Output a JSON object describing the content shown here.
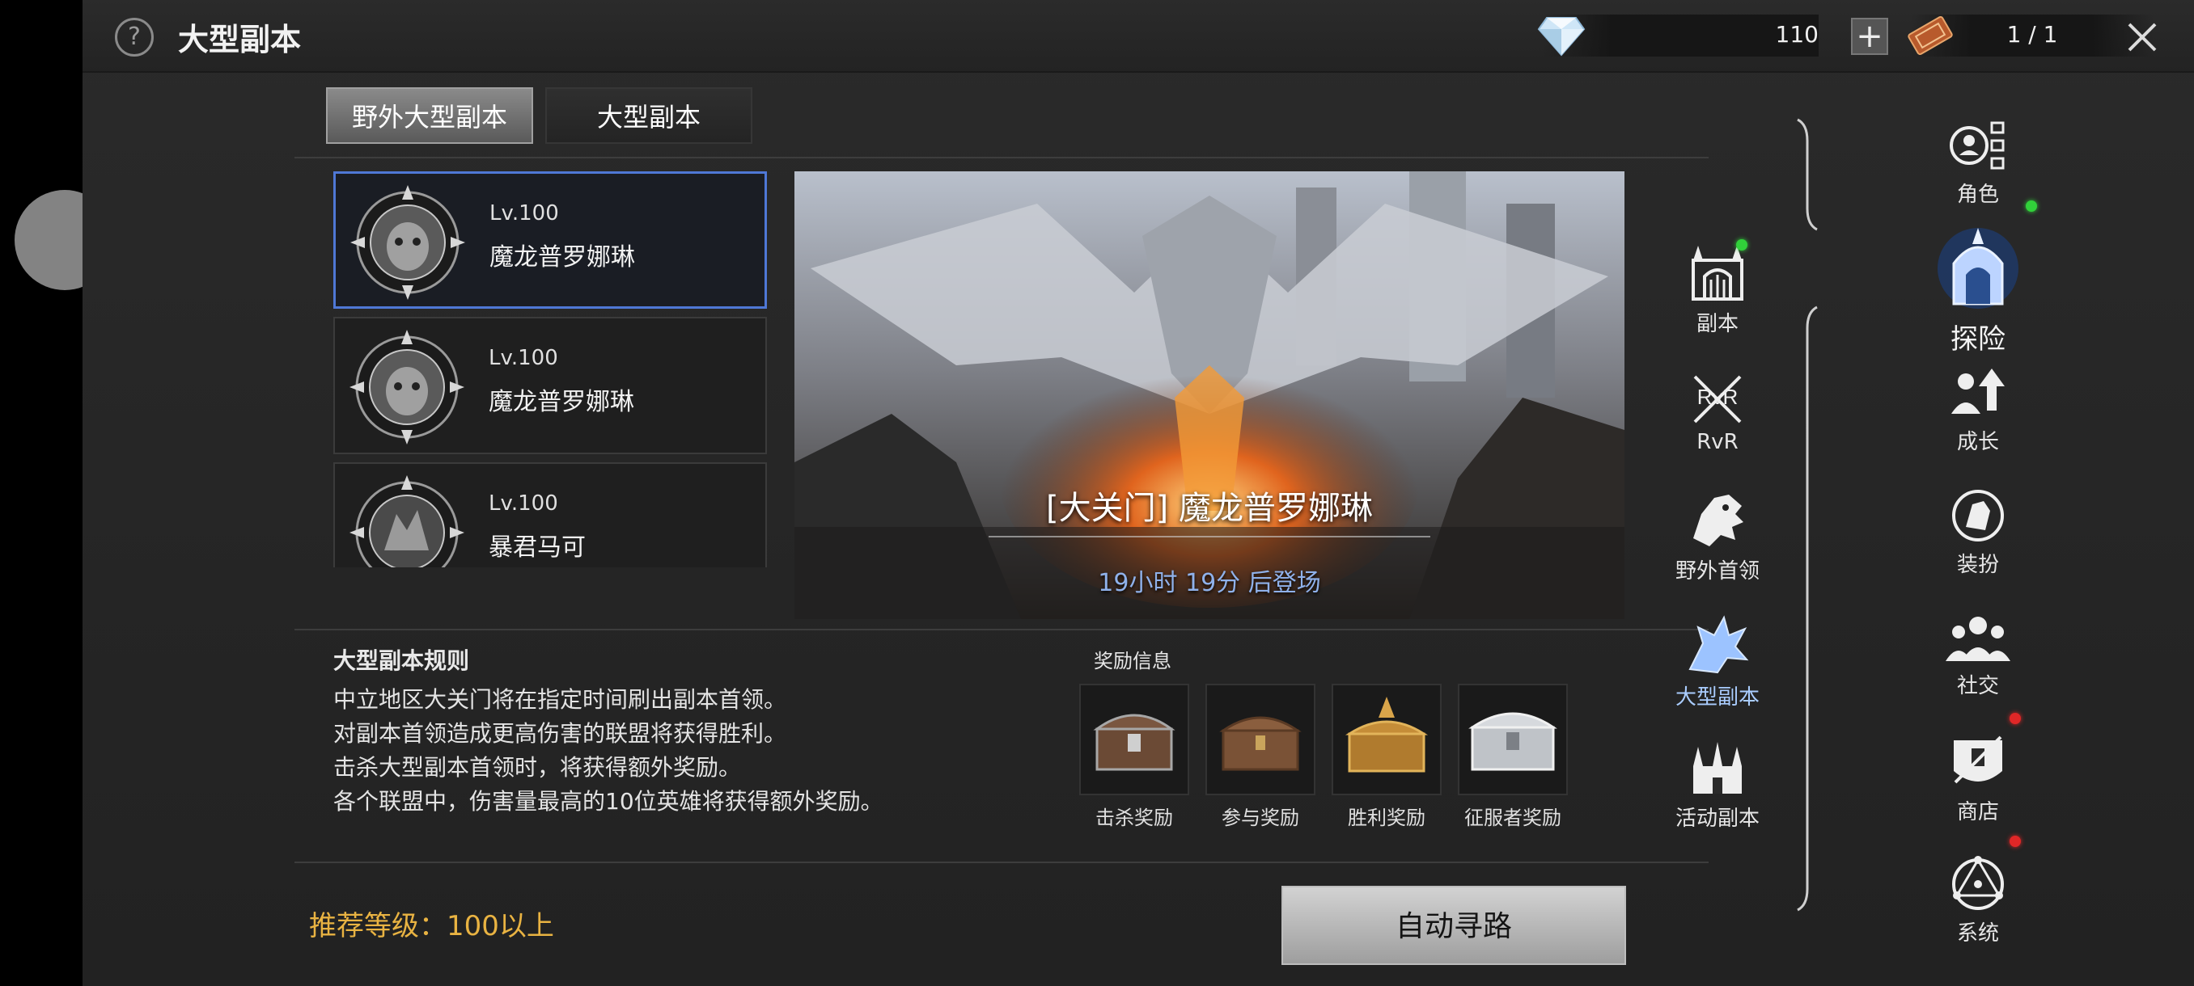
{
  "header": {
    "title": "大型副本",
    "gem_value": "110",
    "ticket_value": "1 / 1",
    "plus_label": "+"
  },
  "tabs": [
    {
      "label": "野外大型副本",
      "active": true
    },
    {
      "label": "大型副本",
      "active": false
    }
  ],
  "bosses": [
    {
      "level": "Lv.100",
      "name": "魔龙普罗娜琳",
      "selected": true
    },
    {
      "level": "Lv.100",
      "name": "魔龙普罗娜琳",
      "selected": false
    },
    {
      "level": "Lv.100",
      "name": "暴君马可",
      "selected": false
    }
  ],
  "banner": {
    "title": "[大关门] 魔龙普罗娜琳",
    "time": "19小时 19分 后登场"
  },
  "rules": {
    "title": "大型副本规则",
    "lines": [
      "中立地区大关门将在指定时间刷出副本首领。",
      "对副本首领造成更高伤害的联盟将获得胜利。",
      "击杀大型副本首领时，将获得额外奖励。",
      "各个联盟中，伤害量最高的10位英雄将获得额外奖励。"
    ]
  },
  "rewards": {
    "title": "奖励信息",
    "items": [
      {
        "label": "击杀奖励",
        "icon": "kill-reward-chest"
      },
      {
        "label": "参与奖励",
        "icon": "participation-reward-chest"
      },
      {
        "label": "胜利奖励",
        "icon": "victory-reward-chest"
      },
      {
        "label": "征服者奖励",
        "icon": "conqueror-reward-chest"
      }
    ]
  },
  "footer": {
    "recommend": "推荐等级：100以上",
    "auto_path": "自动寻路"
  },
  "mid_nav": [
    {
      "label": "副本",
      "icon": "gate-icon",
      "badge": "green"
    },
    {
      "label": "RvR",
      "icon": "rvr-swords-icon",
      "badge": null
    },
    {
      "label": "野外首领",
      "icon": "dragon-head-icon",
      "badge": null
    },
    {
      "label": "大型副本",
      "icon": "raid-dragon-icon",
      "badge": null,
      "active": true
    },
    {
      "label": "活动副本",
      "icon": "castle-icon",
      "badge": null
    }
  ],
  "right_nav": [
    {
      "label": "角色",
      "icon": "character-icon",
      "badge": null
    },
    {
      "label": "探险",
      "icon": "adventure-icon",
      "badge": "green",
      "active": true
    },
    {
      "label": "成长",
      "icon": "growth-icon",
      "badge": null
    },
    {
      "label": "装扮",
      "icon": "costume-icon",
      "badge": null
    },
    {
      "label": "社交",
      "icon": "social-icon",
      "badge": null
    },
    {
      "label": "商店",
      "icon": "shop-icon",
      "badge": "red"
    },
    {
      "label": "系统",
      "icon": "system-icon",
      "badge": "red"
    }
  ],
  "colors": {
    "selected_border": "#4f78d6",
    "recommend_text": "#e9b342",
    "banner_time": "#8fb1ea",
    "badge_green": "#31d13a",
    "badge_red": "#e02727"
  }
}
